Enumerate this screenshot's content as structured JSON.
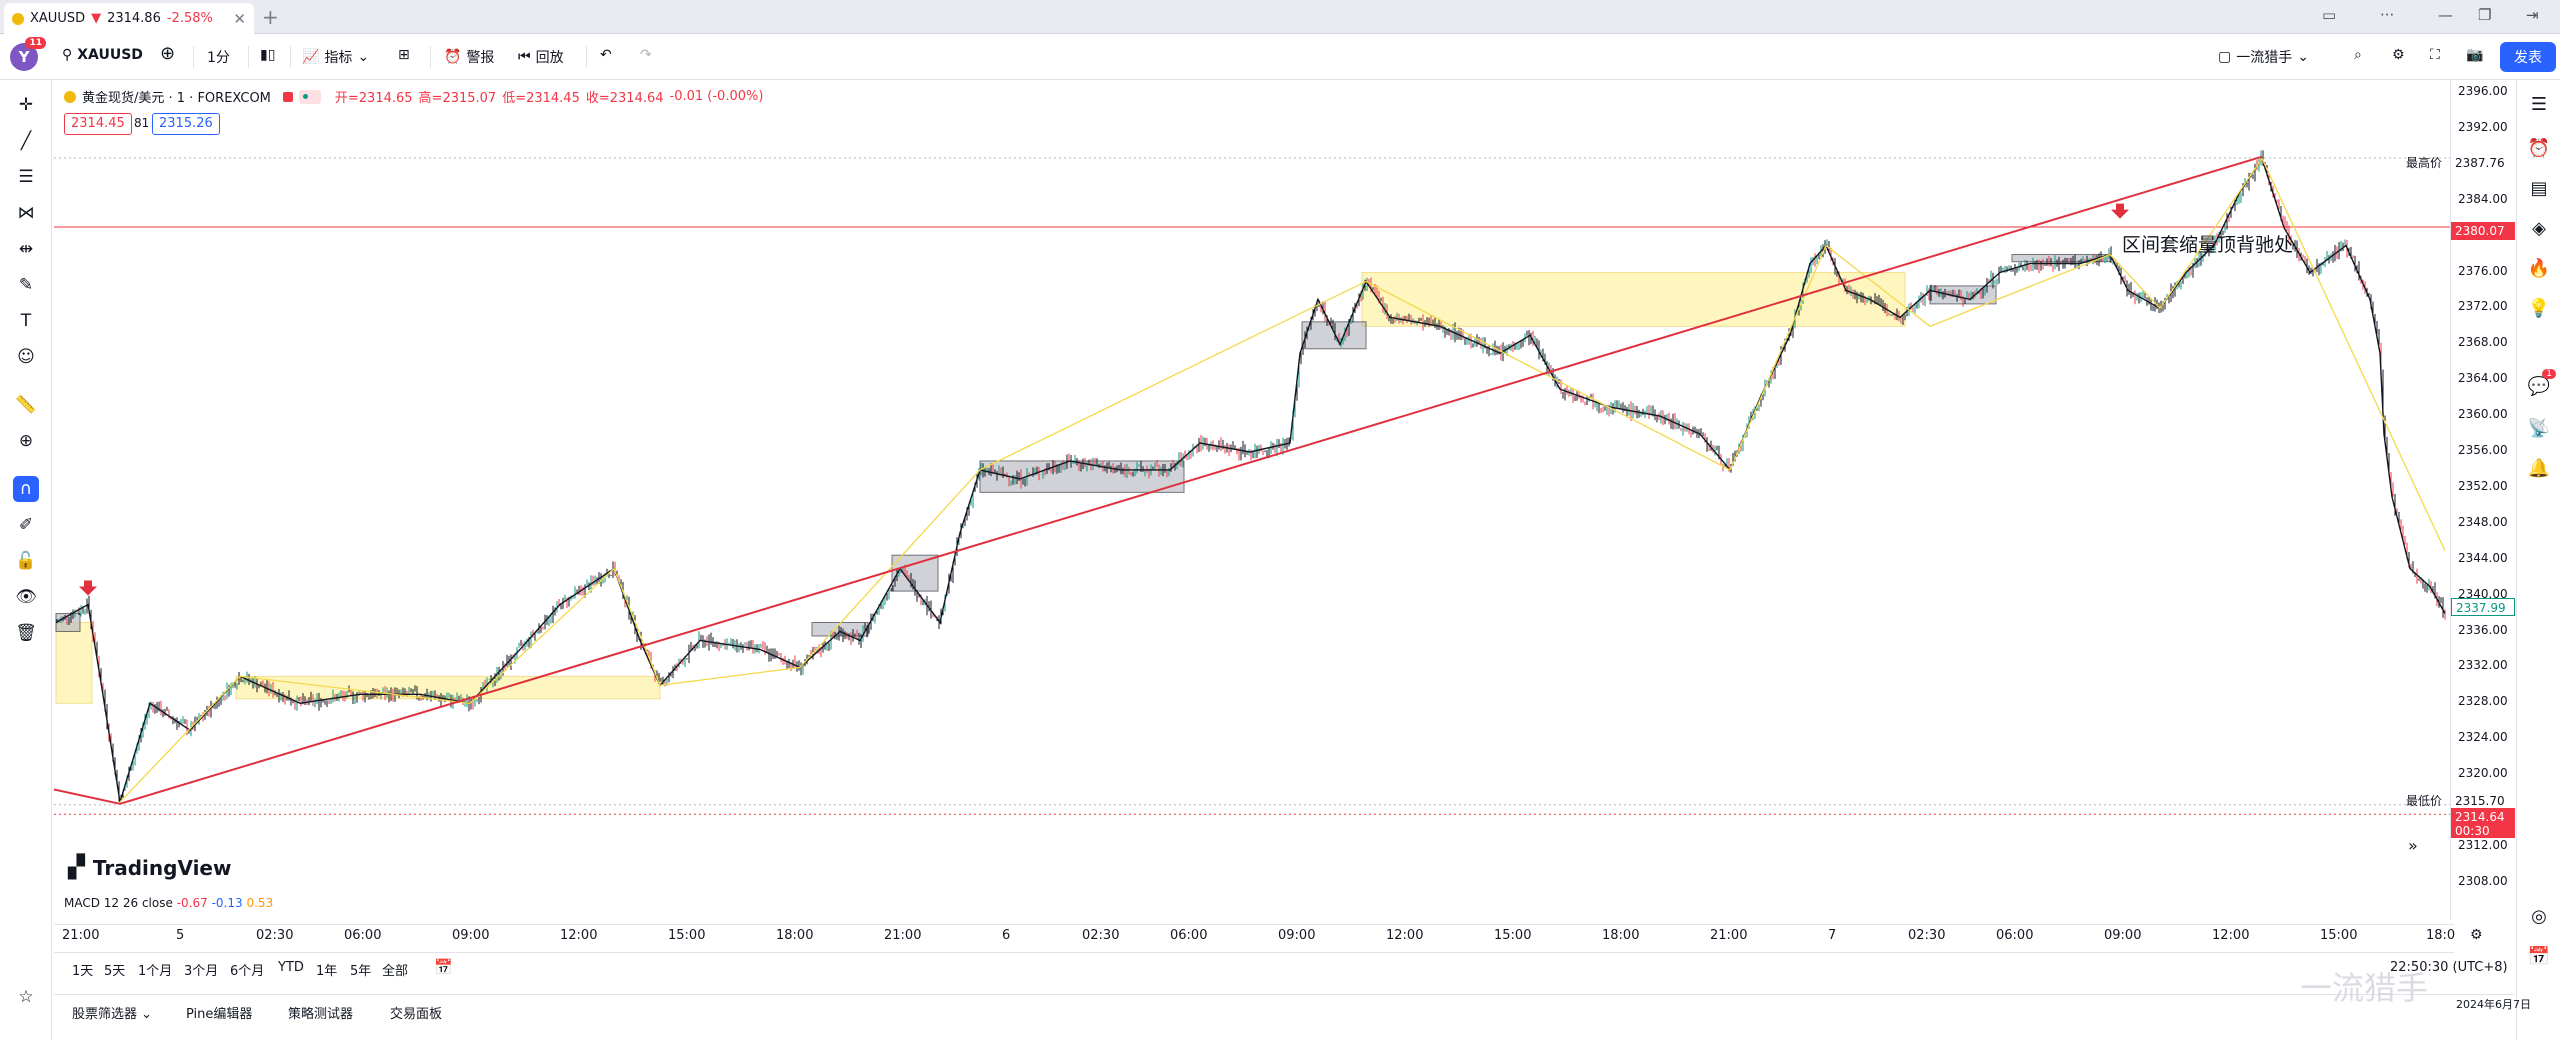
{
  "tab": {
    "symbol": "XAUUSD",
    "price": "2314.86",
    "change": "-2.58%"
  },
  "toolbar": {
    "avatar_letter": "Y",
    "avatar_badge": "11",
    "symbol": "XAUUSD",
    "interval": "1分",
    "indicators": "指标",
    "alerts": "警报",
    "replay": "回放",
    "layout": "一流猎手",
    "publish": "发表"
  },
  "legend": {
    "title": "黄金现货/美元 · 1 · FOREXCOM",
    "open": "开=2314.65",
    "high": "高=2315.07",
    "low": "低=2314.45",
    "close": "收=2314.64",
    "change": "-0.01 (-0.00%)",
    "bid": "2314.45",
    "spread": "81",
    "ask": "2315.26"
  },
  "price_scale": {
    "ticks": [
      "2396.00",
      "2392.00",
      "2388.00",
      "2384.00",
      "2380.00",
      "2376.00",
      "2372.00",
      "2368.00",
      "2364.00",
      "2360.00",
      "2356.00",
      "2352.00",
      "2348.00",
      "2344.00",
      "2340.00",
      "2336.00",
      "2332.00",
      "2328.00",
      "2324.00",
      "2320.00",
      "2316.00",
      "2312.00",
      "2308.00"
    ],
    "high_label": "最高价",
    "high_value": "2387.76",
    "hline_value": "2380.07",
    "last_value": "2337.99",
    "low_label": "最低价",
    "low_value": "2315.70",
    "current_value": "2314.64",
    "countdown": "00:30"
  },
  "time_axis": [
    "21:00",
    "5",
    "02:30",
    "06:00",
    "09:00",
    "12:00",
    "15:00",
    "18:00",
    "21:00",
    "6",
    "02:30",
    "06:00",
    "09:00",
    "12:00",
    "15:00",
    "18:00",
    "21:00",
    "7",
    "02:30",
    "06:00",
    "09:00",
    "12:00",
    "15:00",
    "18:0"
  ],
  "annotation": "区间套缩量顶背驰处",
  "logo": "TradingView",
  "macd": {
    "label": "MACD 12 26 close",
    "v1": "-0.67",
    "v2": "-0.13",
    "v3": "0.53"
  },
  "ranges": [
    "1天",
    "5天",
    "1个月",
    "3个月",
    "6个月",
    "YTD",
    "1年",
    "5年",
    "全部"
  ],
  "bottom_tabs": [
    "股票筛选器",
    "Pine编辑器",
    "策略测试器",
    "交易面板"
  ],
  "clock": "22:50:30 (UTC+8)",
  "watermark": "一流猎手",
  "date_stamp": "2024年6月7日",
  "colors": {
    "up": "#089981",
    "down": "#f23645",
    "trendline": "#e0303e",
    "zone": "#fff3b0",
    "accent": "#2962ff"
  }
}
